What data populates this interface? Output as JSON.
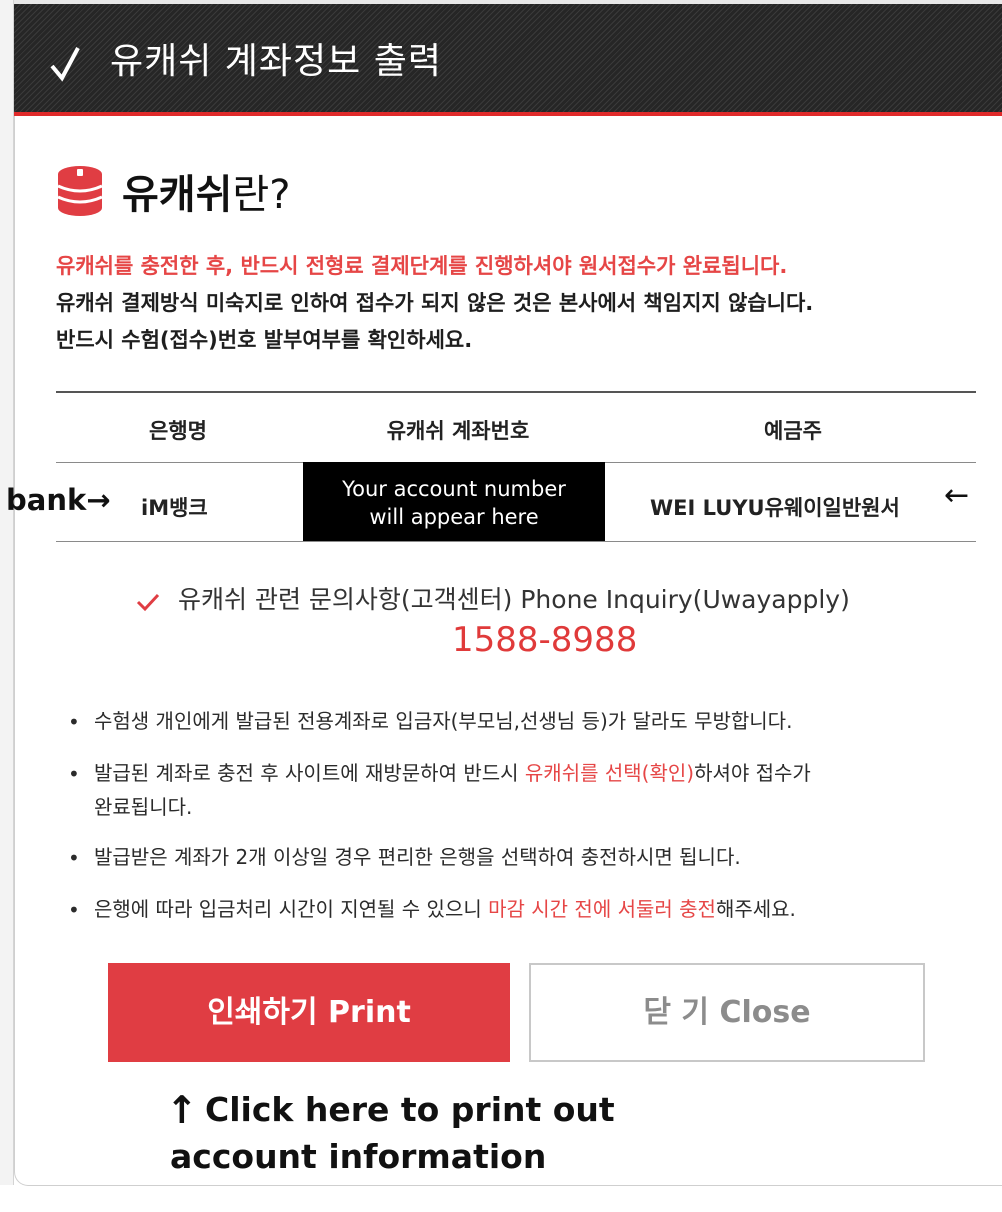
{
  "dialog": {
    "title": "유캐쉬 계좌정보 출력",
    "heading_bold": "유캐쉬",
    "heading_rest": "란?",
    "notices": [
      "유캐쉬를 충전한 후, 반드시 전형료 결제단계를 진행하셔야 원서접수가 완료됩니다.",
      "유캐쉬 결제방식 미숙지로 인하여 접수가 되지 않은 것은 본사에서 책임지지 않습니다.",
      "반드시 수험(접수)번호 발부여부를 확인하세요."
    ]
  },
  "table": {
    "headers": [
      "은행명",
      "유캐쉬 계좌번호",
      "예금주"
    ],
    "row": {
      "bank": "iM뱅크",
      "account_placeholder_line1": "Your account number",
      "account_placeholder_line2": "will appear here",
      "holder": "WEI LUYU유웨이일반원서"
    }
  },
  "annotations": {
    "bank_label": "bank→",
    "holder_arrow": "←",
    "up_arrow": "↑",
    "print_hint_line1": "Click here to print out",
    "print_hint_line2": "account information"
  },
  "inquiry": {
    "label": "유캐쉬 관련 문의사항(고객센터) Phone Inquiry(Uwayapply)",
    "phone": "1588-8988"
  },
  "bullets": {
    "b1": "수험생 개인에게 발급된 전용계좌로 입금자(부모님,선생님 등)가 달라도 무방합니다.",
    "b2_pre": "발급된 계좌로 충전 후 사이트에 재방문하여 반드시 ",
    "b2_red": "유캐쉬를 선택(확인)",
    "b2_post": "하셔야 접수가",
    "b2_line2": "완료됩니다.",
    "b3": "발급받은 계좌가 2개 이상일 경우 편리한 은행을 선택하여 충전하시면 됩니다.",
    "b4_pre": "은행에 따라 입금처리 시간이 지연될 수 있으니 ",
    "b4_red": "마감 시간 전에 서둘러 충전",
    "b4_post": "해주세요.",
    "marker": "•"
  },
  "buttons": {
    "print": "인쇄하기 Print",
    "close": "닫 기 Close"
  },
  "colors": {
    "accent_red": "#e03d43",
    "notice_red": "#e64646",
    "titlebar": "#262626"
  },
  "icons": [
    "check-icon",
    "coin-stack-icon",
    "red-check-icon"
  ]
}
